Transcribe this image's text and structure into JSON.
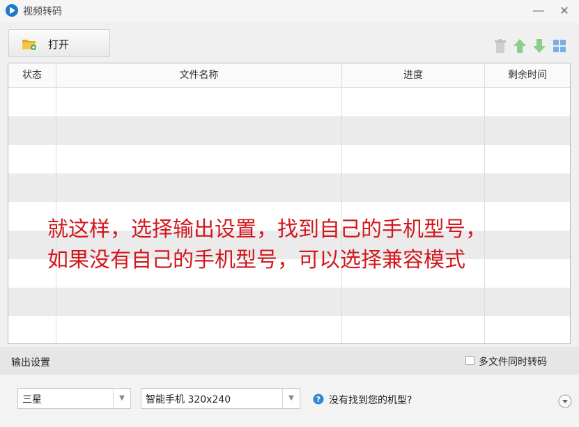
{
  "window": {
    "title": "视频转码",
    "minimize": "—",
    "close": "✕"
  },
  "toolbar": {
    "open_label": "打开"
  },
  "table": {
    "columns": [
      "状态",
      "文件名称",
      "进度",
      "剩余时间"
    ],
    "row_count": 9
  },
  "annotation": {
    "lines": [
      "就这样，选择输出设置，找到自己的手机型号，",
      "如果没有自己的手机型号，可以选择兼容模式"
    ],
    "color": "#d2181e"
  },
  "output": {
    "label": "输出设置",
    "multi_label": "多文件同时转码",
    "multi_checked": false,
    "brand": "三星",
    "model": "智能手机  320x240",
    "help": "没有找到您的机型?"
  }
}
